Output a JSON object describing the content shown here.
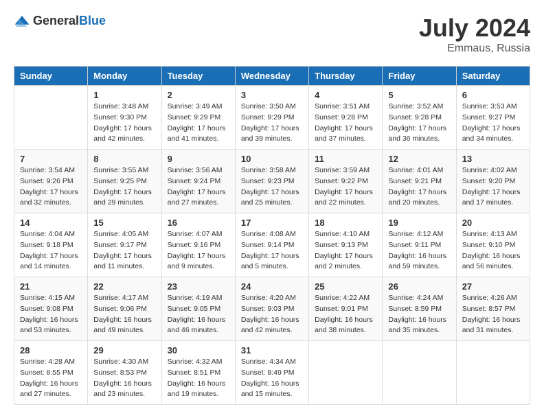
{
  "header": {
    "logo_general": "General",
    "logo_blue": "Blue",
    "month_year": "July 2024",
    "location": "Emmaus, Russia"
  },
  "days_of_week": [
    "Sunday",
    "Monday",
    "Tuesday",
    "Wednesday",
    "Thursday",
    "Friday",
    "Saturday"
  ],
  "weeks": [
    [
      {
        "day": "",
        "info": ""
      },
      {
        "day": "1",
        "info": "Sunrise: 3:48 AM\nSunset: 9:30 PM\nDaylight: 17 hours\nand 42 minutes."
      },
      {
        "day": "2",
        "info": "Sunrise: 3:49 AM\nSunset: 9:29 PM\nDaylight: 17 hours\nand 41 minutes."
      },
      {
        "day": "3",
        "info": "Sunrise: 3:50 AM\nSunset: 9:29 PM\nDaylight: 17 hours\nand 39 minutes."
      },
      {
        "day": "4",
        "info": "Sunrise: 3:51 AM\nSunset: 9:28 PM\nDaylight: 17 hours\nand 37 minutes."
      },
      {
        "day": "5",
        "info": "Sunrise: 3:52 AM\nSunset: 9:28 PM\nDaylight: 17 hours\nand 36 minutes."
      },
      {
        "day": "6",
        "info": "Sunrise: 3:53 AM\nSunset: 9:27 PM\nDaylight: 17 hours\nand 34 minutes."
      }
    ],
    [
      {
        "day": "7",
        "info": "Sunrise: 3:54 AM\nSunset: 9:26 PM\nDaylight: 17 hours\nand 32 minutes."
      },
      {
        "day": "8",
        "info": "Sunrise: 3:55 AM\nSunset: 9:25 PM\nDaylight: 17 hours\nand 29 minutes."
      },
      {
        "day": "9",
        "info": "Sunrise: 3:56 AM\nSunset: 9:24 PM\nDaylight: 17 hours\nand 27 minutes."
      },
      {
        "day": "10",
        "info": "Sunrise: 3:58 AM\nSunset: 9:23 PM\nDaylight: 17 hours\nand 25 minutes."
      },
      {
        "day": "11",
        "info": "Sunrise: 3:59 AM\nSunset: 9:22 PM\nDaylight: 17 hours\nand 22 minutes."
      },
      {
        "day": "12",
        "info": "Sunrise: 4:01 AM\nSunset: 9:21 PM\nDaylight: 17 hours\nand 20 minutes."
      },
      {
        "day": "13",
        "info": "Sunrise: 4:02 AM\nSunset: 9:20 PM\nDaylight: 17 hours\nand 17 minutes."
      }
    ],
    [
      {
        "day": "14",
        "info": "Sunrise: 4:04 AM\nSunset: 9:18 PM\nDaylight: 17 hours\nand 14 minutes."
      },
      {
        "day": "15",
        "info": "Sunrise: 4:05 AM\nSunset: 9:17 PM\nDaylight: 17 hours\nand 11 minutes."
      },
      {
        "day": "16",
        "info": "Sunrise: 4:07 AM\nSunset: 9:16 PM\nDaylight: 17 hours\nand 9 minutes."
      },
      {
        "day": "17",
        "info": "Sunrise: 4:08 AM\nSunset: 9:14 PM\nDaylight: 17 hours\nand 5 minutes."
      },
      {
        "day": "18",
        "info": "Sunrise: 4:10 AM\nSunset: 9:13 PM\nDaylight: 17 hours\nand 2 minutes."
      },
      {
        "day": "19",
        "info": "Sunrise: 4:12 AM\nSunset: 9:11 PM\nDaylight: 16 hours\nand 59 minutes."
      },
      {
        "day": "20",
        "info": "Sunrise: 4:13 AM\nSunset: 9:10 PM\nDaylight: 16 hours\nand 56 minutes."
      }
    ],
    [
      {
        "day": "21",
        "info": "Sunrise: 4:15 AM\nSunset: 9:08 PM\nDaylight: 16 hours\nand 53 minutes."
      },
      {
        "day": "22",
        "info": "Sunrise: 4:17 AM\nSunset: 9:06 PM\nDaylight: 16 hours\nand 49 minutes."
      },
      {
        "day": "23",
        "info": "Sunrise: 4:19 AM\nSunset: 9:05 PM\nDaylight: 16 hours\nand 46 minutes."
      },
      {
        "day": "24",
        "info": "Sunrise: 4:20 AM\nSunset: 9:03 PM\nDaylight: 16 hours\nand 42 minutes."
      },
      {
        "day": "25",
        "info": "Sunrise: 4:22 AM\nSunset: 9:01 PM\nDaylight: 16 hours\nand 38 minutes."
      },
      {
        "day": "26",
        "info": "Sunrise: 4:24 AM\nSunset: 8:59 PM\nDaylight: 16 hours\nand 35 minutes."
      },
      {
        "day": "27",
        "info": "Sunrise: 4:26 AM\nSunset: 8:57 PM\nDaylight: 16 hours\nand 31 minutes."
      }
    ],
    [
      {
        "day": "28",
        "info": "Sunrise: 4:28 AM\nSunset: 8:55 PM\nDaylight: 16 hours\nand 27 minutes."
      },
      {
        "day": "29",
        "info": "Sunrise: 4:30 AM\nSunset: 8:53 PM\nDaylight: 16 hours\nand 23 minutes."
      },
      {
        "day": "30",
        "info": "Sunrise: 4:32 AM\nSunset: 8:51 PM\nDaylight: 16 hours\nand 19 minutes."
      },
      {
        "day": "31",
        "info": "Sunrise: 4:34 AM\nSunset: 8:49 PM\nDaylight: 16 hours\nand 15 minutes."
      },
      {
        "day": "",
        "info": ""
      },
      {
        "day": "",
        "info": ""
      },
      {
        "day": "",
        "info": ""
      }
    ]
  ]
}
